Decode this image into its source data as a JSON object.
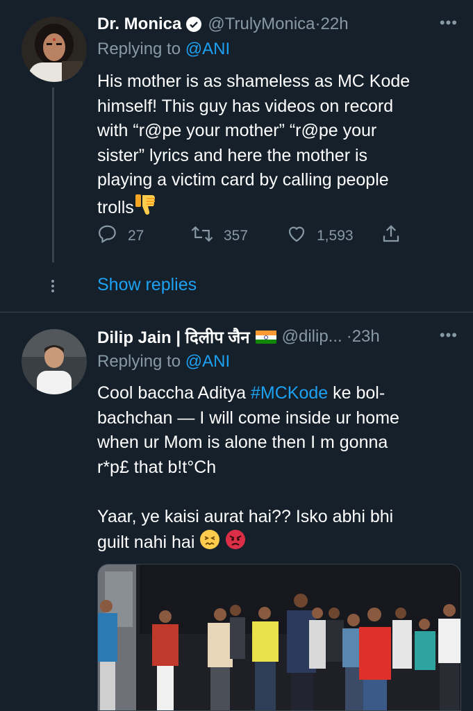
{
  "tweets": [
    {
      "name": "Dr. Monica",
      "handle": "@TrulyMonica",
      "dot": "·",
      "time": "22h",
      "replying_label": "Replying to",
      "replying_handle": "@ANI",
      "text": "His mother is as shameless as MC Kode\nhimself! This guy has videos on record\nwith “r@pe your mother” “r@pe your\nsister” lyrics and here the mother is\nplaying a victim card by calling people\ntrolls",
      "emoji": "thumbs-down",
      "replies": "27",
      "retweets": "357",
      "likes": "1,593",
      "show_replies": "Show replies",
      "verified": true
    },
    {
      "name": "Dilip Jain | दिलीप जैन",
      "handle": "@dilip...",
      "dot": "·",
      "time": "23h",
      "replying_label": "Replying to",
      "replying_handle": "@ANI",
      "text_before_hashtag": "Cool baccha Aditya ",
      "hashtag": "#MCKode",
      "text_after_hashtag": " ke bol-\nbachchan — I will come inside ur home\nwhen ur Mom is alone then I m gonna\nr*p£ that b!t°Ch\n\nYaar, ye kaisi aurat hai?? Isko abhi bhi\nguilt nahi hai",
      "emojis": [
        "confounded-face",
        "angry-face"
      ],
      "flag": "india-flag"
    }
  ],
  "colors": {
    "background": "#15202b",
    "secondary_text": "#8899a6",
    "link": "#1da1f2",
    "divider": "#38444d"
  }
}
